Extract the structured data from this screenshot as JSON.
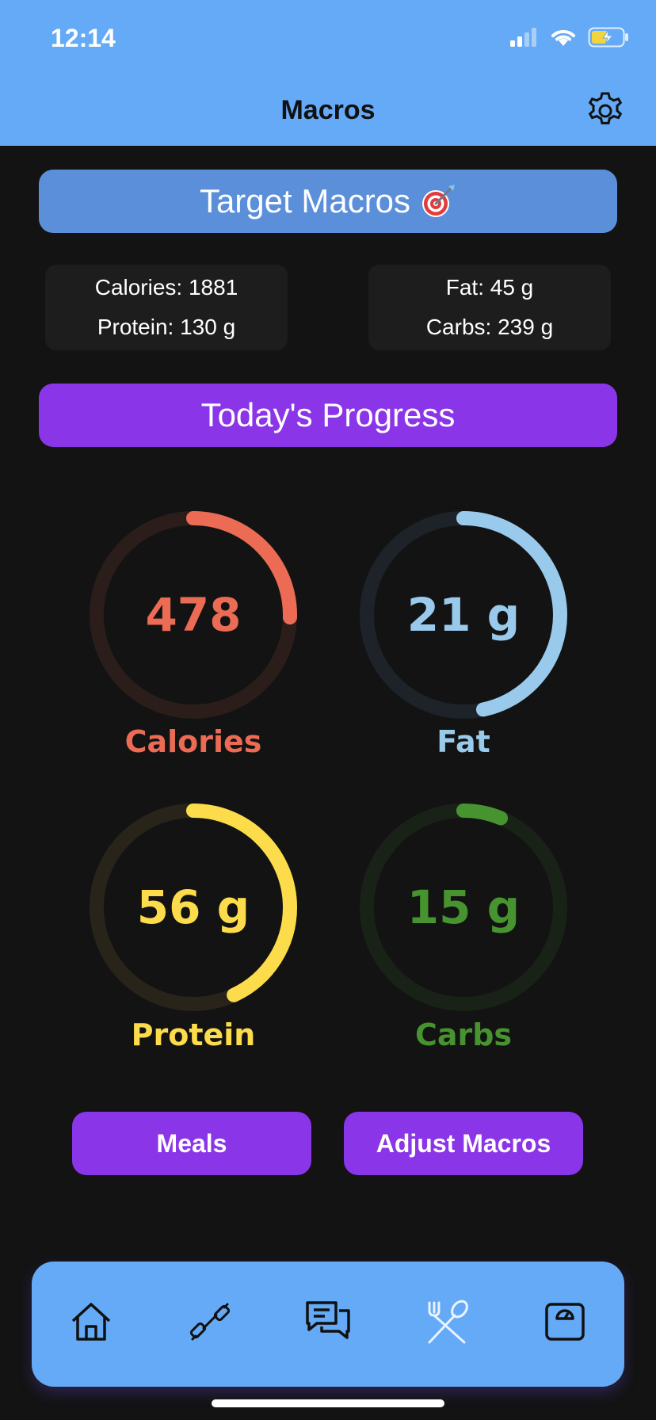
{
  "status_bar": {
    "time": "12:14"
  },
  "nav": {
    "title": "Macros"
  },
  "target": {
    "title": "Target Macros",
    "calories": "Calories: 1881",
    "protein": "Protein: 130 g",
    "fat": "Fat: 45 g",
    "carbs": "Carbs: 239 g"
  },
  "progress": {
    "title": "Today's Progress",
    "rings": [
      {
        "value": "478",
        "label": "Calories",
        "color": "#ec6b54",
        "track": "#2a1d1a",
        "fraction": 0.254
      },
      {
        "value": "21 g",
        "label": "Fat",
        "color": "#99caeb",
        "track": "#1d2329",
        "fraction": 0.467
      },
      {
        "value": "56 g",
        "label": "Protein",
        "color": "#fddc4b",
        "track": "#28241a",
        "fraction": 0.431
      },
      {
        "value": "15 g",
        "label": "Carbs",
        "color": "#46932f",
        "track": "#192217",
        "fraction": 0.063
      }
    ]
  },
  "actions": {
    "meals": "Meals",
    "adjust": "Adjust Macros"
  },
  "tabbar": {
    "icons": [
      "home-icon",
      "dumbbell-icon",
      "chat-icon",
      "fork-spoon-icon",
      "scale-icon"
    ]
  },
  "colors": {
    "accent": "#8b35e8",
    "primary": "#64aaf6",
    "target_card": "#5b8fda",
    "background": "#131313"
  }
}
